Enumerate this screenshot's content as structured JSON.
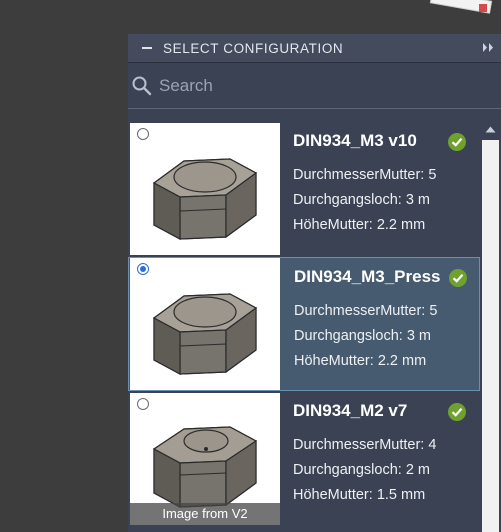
{
  "panel": {
    "title": "SELECT CONFIGURATION"
  },
  "search": {
    "placeholder": "Search"
  },
  "configurations": [
    {
      "name": "DIN934_M3 v10",
      "params": [
        "DurchmesserMutter: 5",
        "Durchgangsloch: 3 m",
        "HöheMutter: 2.2 mm"
      ],
      "selected": false,
      "caption": ""
    },
    {
      "name": "DIN934_M3_Press",
      "params": [
        "DurchmesserMutter: 5",
        "Durchgangsloch: 3 m",
        "HöheMutter: 2.2 mm"
      ],
      "selected": true,
      "caption": ""
    },
    {
      "name": "DIN934_M2 v7",
      "params": [
        "DurchmesserMutter: 4",
        "Durchgangsloch: 2 m",
        "HöheMutter: 1.5 mm"
      ],
      "selected": false,
      "caption": "Image from V2"
    }
  ],
  "icons": {
    "collapse": "minus-icon",
    "expand": "double-chevron-right-icon",
    "search": "magnifier-icon",
    "status": "green-check-circle-icon",
    "scroll": "scroll-up-arrow-icon"
  },
  "colors": {
    "panel_bg": "#3a4253",
    "selected_bg": "#465b70",
    "check_green": "#6fa12f",
    "radio_blue": "#2a6fd6"
  }
}
